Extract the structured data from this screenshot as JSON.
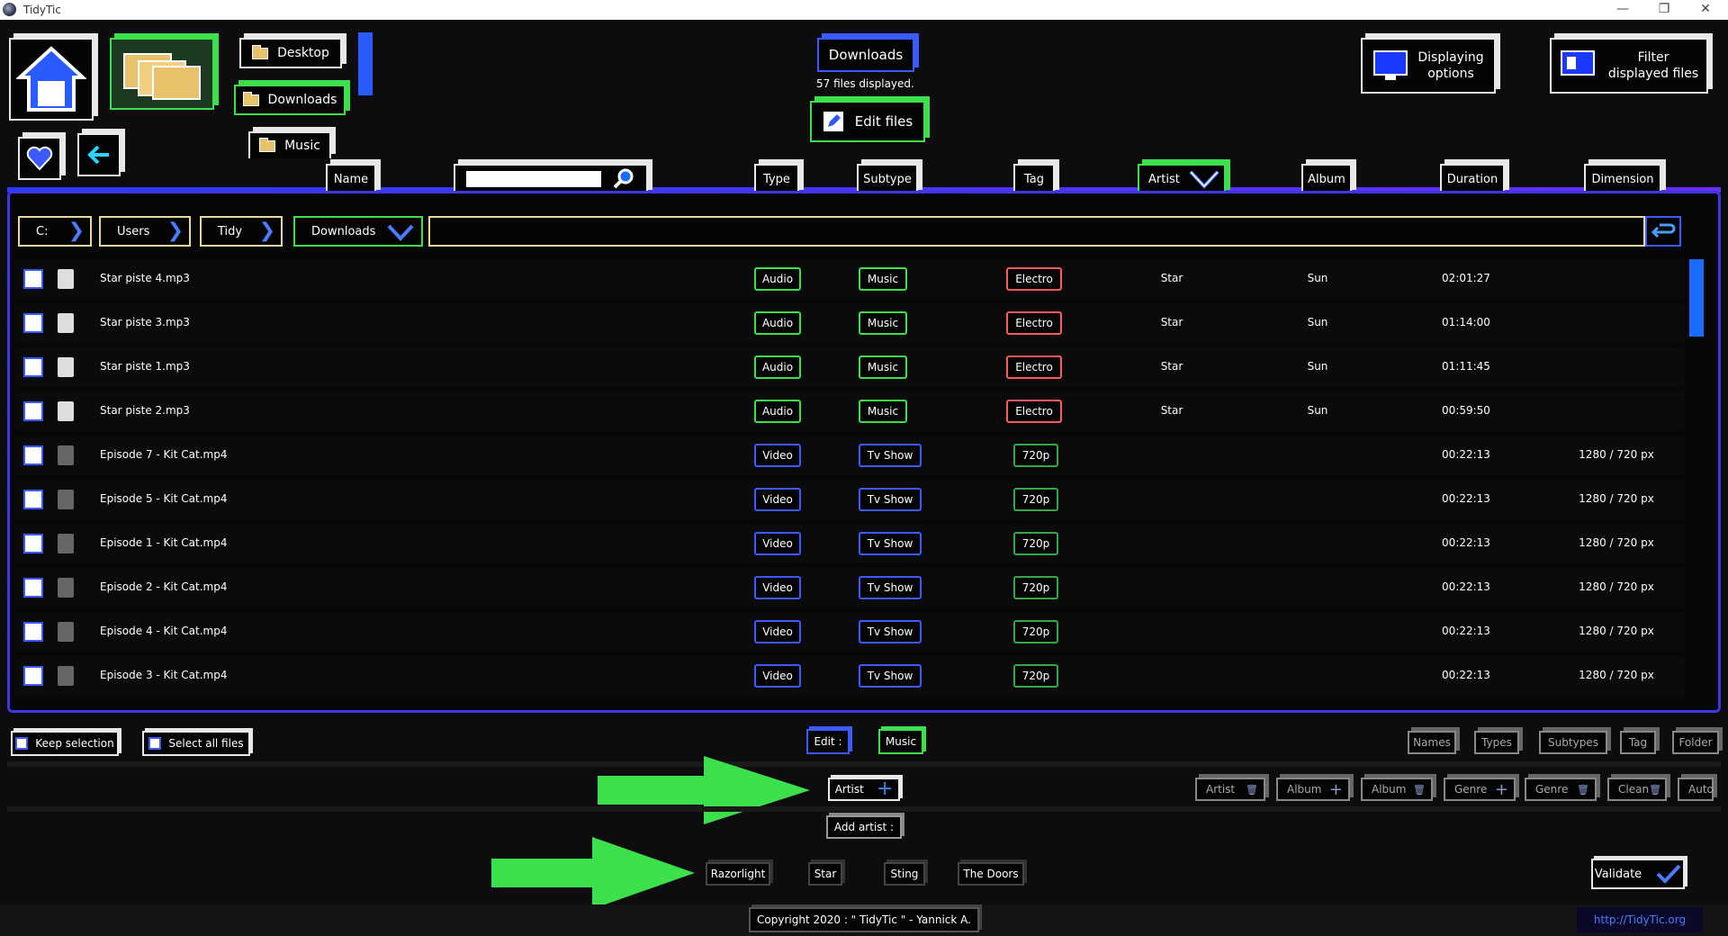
{
  "window": {
    "title": "TidyTic",
    "min": "—",
    "restore": "❐",
    "close": "✕"
  },
  "nav": {
    "desktop": "Desktop",
    "downloads": "Downloads",
    "music": "Music"
  },
  "current": {
    "folder": "Downloads",
    "count": "57 files displayed.",
    "edit_files": "Edit files"
  },
  "top_right": {
    "display_options": "Displaying\noptions",
    "filter": "Filter\ndisplayed files"
  },
  "columns": {
    "name": "Name",
    "search_placeholder": "",
    "type": "Type",
    "subtype": "Subtype",
    "tag": "Tag",
    "artist": "Artist",
    "album": "Album",
    "duration": "Duration",
    "dimension": "Dimension"
  },
  "breadcrumb": [
    "C:",
    "Users",
    "Tidy",
    "Downloads"
  ],
  "files": [
    {
      "name": "Star piste 4.mp3",
      "type": "Audio",
      "subtype": "Music",
      "tag": "Electro",
      "artist": "Star",
      "album": "Sun",
      "duration": "02:01:27",
      "dimension": ""
    },
    {
      "name": "Star piste 3.mp3",
      "type": "Audio",
      "subtype": "Music",
      "tag": "Electro",
      "artist": "Star",
      "album": "Sun",
      "duration": "01:14:00",
      "dimension": ""
    },
    {
      "name": "Star piste 1.mp3",
      "type": "Audio",
      "subtype": "Music",
      "tag": "Electro",
      "artist": "Star",
      "album": "Sun",
      "duration": "01:11:45",
      "dimension": ""
    },
    {
      "name": "Star piste 2.mp3",
      "type": "Audio",
      "subtype": "Music",
      "tag": "Electro",
      "artist": "Star",
      "album": "Sun",
      "duration": "00:59:50",
      "dimension": ""
    },
    {
      "name": "Episode 7 - Kit Cat.mp4",
      "type": "Video",
      "subtype": "Tv Show",
      "tag": "720p",
      "artist": "",
      "album": "",
      "duration": "00:22:13",
      "dimension": "1280 / 720 px"
    },
    {
      "name": "Episode 5 - Kit Cat.mp4",
      "type": "Video",
      "subtype": "Tv Show",
      "tag": "720p",
      "artist": "",
      "album": "",
      "duration": "00:22:13",
      "dimension": "1280 / 720 px"
    },
    {
      "name": "Episode 1 - Kit Cat.mp4",
      "type": "Video",
      "subtype": "Tv Show",
      "tag": "720p",
      "artist": "",
      "album": "",
      "duration": "00:22:13",
      "dimension": "1280 / 720 px"
    },
    {
      "name": "Episode 2 - Kit Cat.mp4",
      "type": "Video",
      "subtype": "Tv Show",
      "tag": "720p",
      "artist": "",
      "album": "",
      "duration": "00:22:13",
      "dimension": "1280 / 720 px"
    },
    {
      "name": "Episode 4 - Kit Cat.mp4",
      "type": "Video",
      "subtype": "Tv Show",
      "tag": "720p",
      "artist": "",
      "album": "",
      "duration": "00:22:13",
      "dimension": "1280 / 720 px"
    },
    {
      "name": "Episode 3 - Kit Cat.mp4",
      "type": "Video",
      "subtype": "Tv Show",
      "tag": "720p",
      "artist": "",
      "album": "",
      "duration": "00:22:13",
      "dimension": "1280 / 720 px"
    }
  ],
  "bottom": {
    "keep_selection": "Keep selection",
    "select_all": "Select all files",
    "edit_label": "Edit :",
    "edit_value": "Music",
    "artist_btn": "Artist",
    "add_artist": "Add artist :",
    "artists": [
      "Razorlight",
      "Star",
      "Sting",
      "The Doors"
    ],
    "validate": "Validate",
    "right_row1": [
      "Names",
      "Types",
      "Subtypes",
      "Tag",
      "Folder"
    ],
    "right_row2": [
      "Artist",
      "Album",
      "Album",
      "Genre",
      "Genre",
      "Clean",
      "Auto"
    ]
  },
  "footer": {
    "copyright": "Copyright 2020 : \" TidyTic \" - Yannick A.",
    "link": "http://TidyTic.org"
  },
  "colors": {
    "accent_blue": "#3b5bff",
    "accent_green": "#3be04a",
    "tag_red": "#ff5a5a"
  }
}
